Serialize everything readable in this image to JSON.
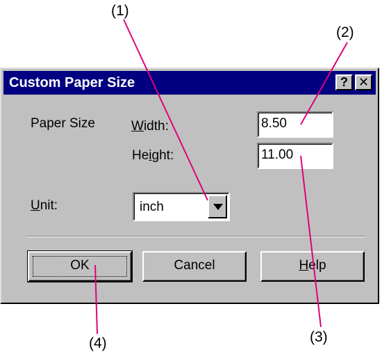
{
  "callouts": {
    "c1": "(1)",
    "c2": "(2)",
    "c3": "(3)",
    "c4": "(4)"
  },
  "dialog": {
    "title": "Custom Paper Size",
    "help_glyph": "?",
    "close_glyph": "✕"
  },
  "form": {
    "paper_size_label": "Paper Size",
    "width_label_u": "W",
    "width_label_rest": "idth:",
    "height_label_pre": "He",
    "height_label_u": "i",
    "height_label_rest": "ght:",
    "width_value": "8.50",
    "height_value": "11.00",
    "unit_label_u": "U",
    "unit_label_rest": "nit:",
    "unit_value": "inch"
  },
  "buttons": {
    "ok": "OK",
    "cancel": "Cancel",
    "help_u": "H",
    "help_rest": "elp"
  },
  "colors": {
    "titlebar": "#000080",
    "face": "#c0c0c0",
    "leader": "#e0007a"
  }
}
